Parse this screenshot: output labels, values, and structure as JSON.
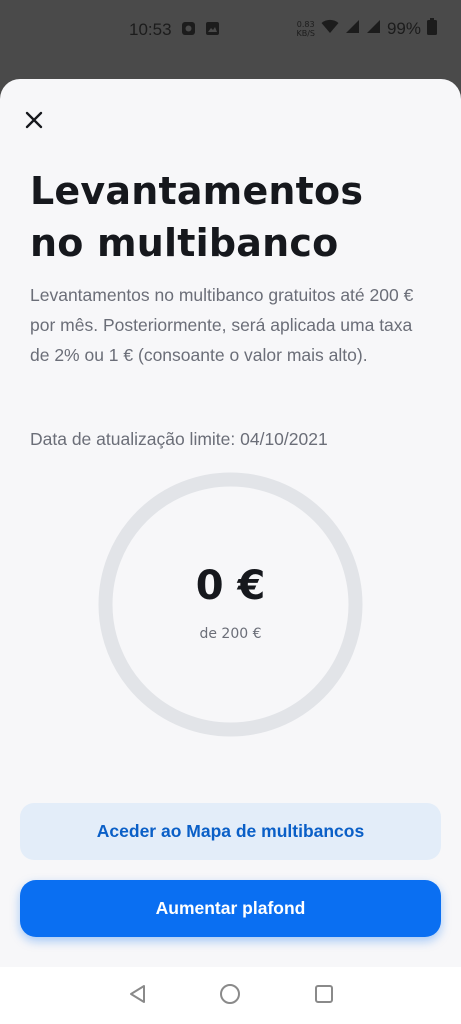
{
  "status_bar": {
    "time": "10:53",
    "net_speed_value": "0.83",
    "net_speed_unit": "KB/S",
    "battery": "99%",
    "icons": [
      "app-notification-icon",
      "image-notification-icon",
      "wifi-icon",
      "signal-icon",
      "signal-icon",
      "battery-icon"
    ]
  },
  "sheet": {
    "close_icon": "close-icon",
    "title": "Levantamentos no multibanco",
    "description": "Levantamentos no multibanco gratuitos até 200 € por mês. Posteriormente, será aplicada uma taxa de 2% ou 1 € (consoante o valor mais alto).",
    "update_date": "Data de atualização limite: 04/10/2021",
    "gauge": {
      "amount": "0 €",
      "limit_label": "de 200 €",
      "used_fraction": 0,
      "track_color": "#e2e4e8",
      "fill_color": "#0a6ff2"
    },
    "secondary_button": "Aceder ao Mapa de multibancos",
    "primary_button": "Aumentar plafond"
  },
  "nav_bar": {
    "icons": [
      "back-icon",
      "home-icon",
      "recents-icon"
    ]
  },
  "colors": {
    "primary": "#0a6ff2",
    "secondary_bg": "#e3edf9",
    "secondary_text": "#0a5fc7",
    "text_dark": "#16181d",
    "text_muted": "#6b6e78"
  }
}
